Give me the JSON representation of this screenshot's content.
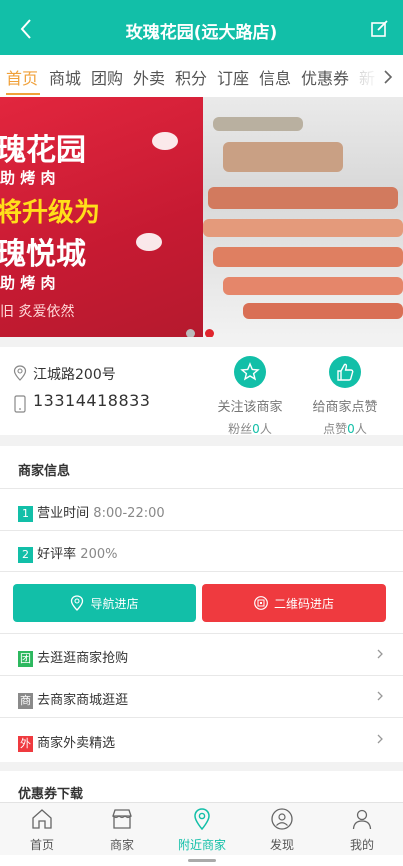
{
  "header": {
    "title": "玫瑰花园(远大路店)",
    "back_icon": "chevron-left-icon",
    "edit_icon": "edit-icon"
  },
  "tabs": [
    {
      "label": "首页",
      "active": true
    },
    {
      "label": "商城"
    },
    {
      "label": "团购"
    },
    {
      "label": "外卖"
    },
    {
      "label": "积分"
    },
    {
      "label": "订座"
    },
    {
      "label": "信息"
    },
    {
      "label": "优惠券"
    },
    {
      "label": "新"
    }
  ],
  "banner": {
    "text_line1": "瑰花园",
    "text_line2": "助 烤 肉",
    "text_line3": "将升级为",
    "text_line4": "瑰悦城",
    "text_line5": "助 烤 肉",
    "text_line6": "旧  炙爱依然",
    "slide_count": 2,
    "active_slide": 2,
    "colors": {
      "red": "#e2263e",
      "dot_active": "#e0262e"
    }
  },
  "store": {
    "address": "江城路200号",
    "phone": "13314418833",
    "follow": {
      "label": "关注该商家",
      "count_prefix": "粉丝",
      "count": "0",
      "count_suffix": "人"
    },
    "like": {
      "label": "给商家点赞",
      "count_prefix": "点赞",
      "count": "0",
      "count_suffix": "人"
    }
  },
  "merchant_info": {
    "title": "商家信息",
    "hours": {
      "index": "1",
      "label": "营业时间",
      "value": "8:00-22:00"
    },
    "rating": {
      "index": "2",
      "label": "好评率",
      "value": "200%"
    }
  },
  "buttons": {
    "navigate": "导航进店",
    "qrcode": "二维码进店"
  },
  "links": [
    {
      "badge": "团",
      "label": "去逛逛商家抢购",
      "badge_color": "#2db85f"
    },
    {
      "badge": "商",
      "label": "去商家商城逛逛",
      "badge_color": "#8a8a8a"
    },
    {
      "badge": "外",
      "label": "商家外卖精选",
      "badge_color": "#ef3a3f"
    }
  ],
  "coupons": {
    "title": "优惠券下载"
  },
  "bottom_nav": [
    {
      "label": "首页",
      "icon": "home-icon"
    },
    {
      "label": "商家",
      "icon": "store-icon"
    },
    {
      "label": "附近商家",
      "icon": "location-icon",
      "active": true
    },
    {
      "label": "发现",
      "icon": "discover-icon"
    },
    {
      "label": "我的",
      "icon": "user-icon"
    }
  ],
  "theme": {
    "primary": "#12bfa8",
    "accent": "#f0a13b",
    "danger": "#ef3a3f"
  }
}
